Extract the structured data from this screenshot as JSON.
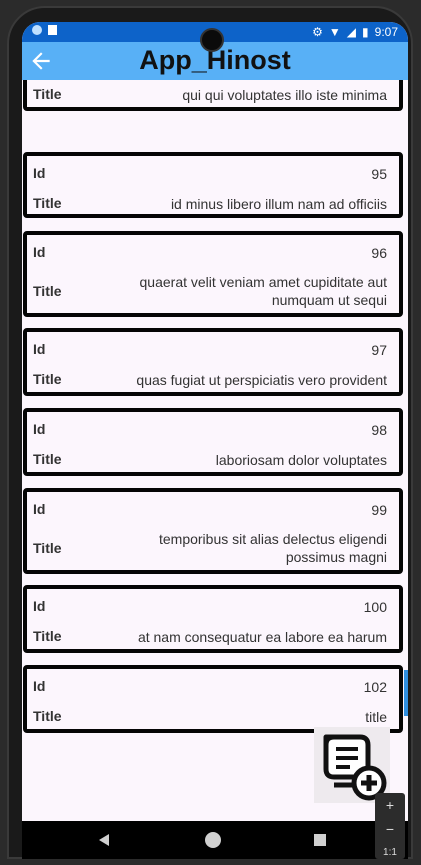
{
  "status_bar": {
    "time": "9:07"
  },
  "app_bar": {
    "title": "App_Hinost",
    "back_icon": "arrow-back-icon"
  },
  "labels": {
    "id": "Id",
    "title": "Title"
  },
  "partial_item": {
    "title": "qui qui voluptates illo iste minima"
  },
  "items": [
    {
      "id": "95",
      "title": "id minus libero illum nam ad officiis"
    },
    {
      "id": "96",
      "title_line1": "quaerat velit veniam amet cupiditate aut",
      "title_line2": "numquam ut sequi"
    },
    {
      "id": "97",
      "title": "quas fugiat ut perspiciatis vero provident"
    },
    {
      "id": "98",
      "title": "laboriosam dolor voluptates"
    },
    {
      "id": "99",
      "title_line1": "temporibus sit alias delectus eligendi",
      "title_line2": "possimus magni"
    },
    {
      "id": "100",
      "title": "at nam consequatur ea labore ea harum"
    },
    {
      "id": "102",
      "title": "title"
    }
  ],
  "fab": {
    "icon": "add-note-icon"
  },
  "nav": {
    "back": "nav-back-icon",
    "home": "nav-home-icon",
    "recents": "nav-recents-icon"
  },
  "zoom_controls": {
    "plus": "+",
    "minus": "−",
    "ratio": "1:1"
  },
  "colors": {
    "status_bar": "#0d63c9",
    "app_bar": "#58b0f6",
    "background": "#fcf6fd",
    "card_border": "#050505"
  }
}
